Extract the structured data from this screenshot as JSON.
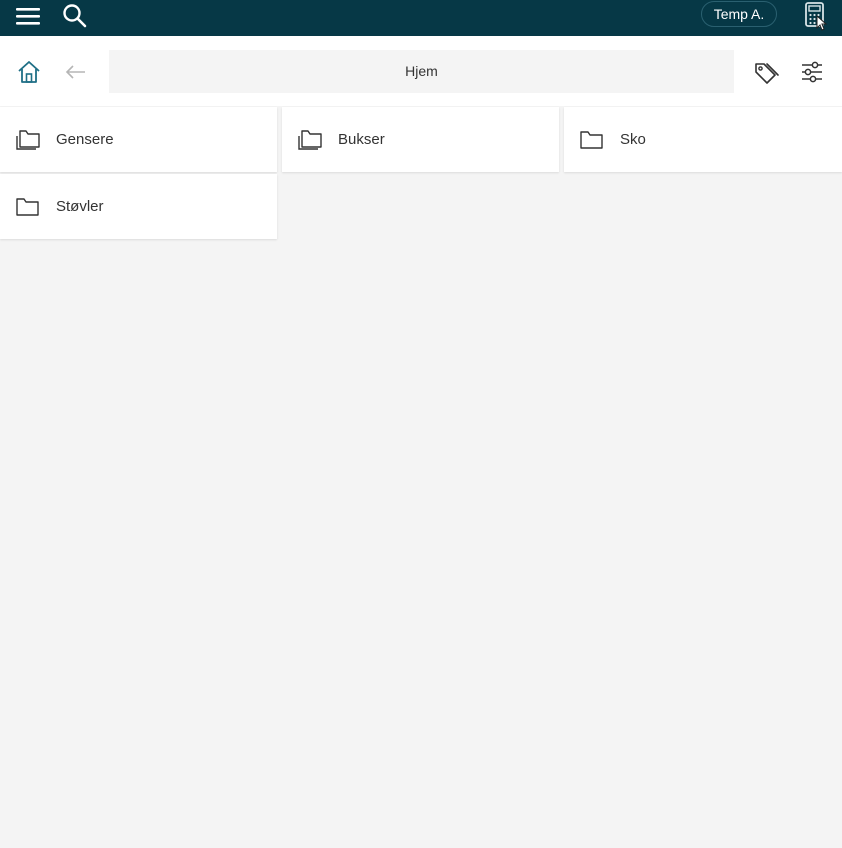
{
  "topbar": {
    "user": "Temp A.",
    "icons": [
      "menu-icon",
      "search-icon",
      "calculator-icon"
    ],
    "color": "#063846"
  },
  "navbar": {
    "breadcrumb": "Hjem",
    "icons": [
      "home-icon",
      "arrow-left-icon",
      "tag-icon",
      "sliders-icon"
    ]
  },
  "folders": [
    {
      "label": "Gensere",
      "icon": "folders-icon"
    },
    {
      "label": "Bukser",
      "icon": "folders-icon"
    },
    {
      "label": "Sko",
      "icon": "folder-icon"
    },
    {
      "label": "Støvler",
      "icon": "folder-icon"
    }
  ]
}
